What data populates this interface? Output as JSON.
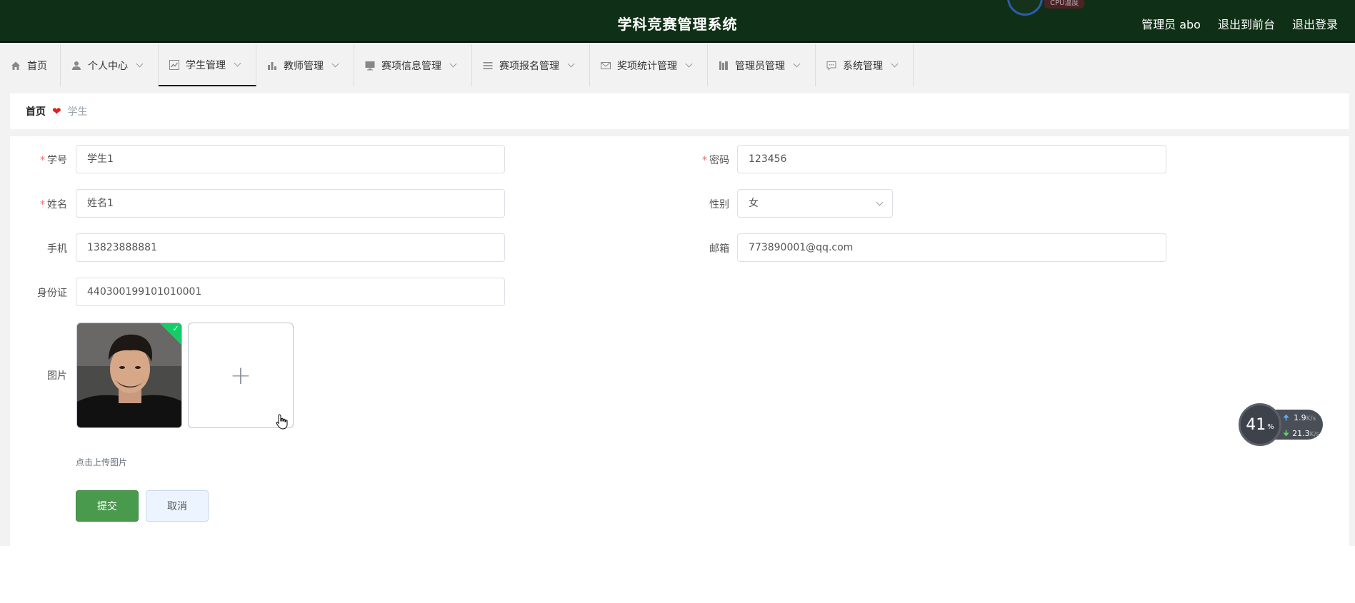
{
  "header": {
    "title": "学科竞赛管理系统",
    "cpu_label": "CPU温度",
    "links": [
      "管理员 abo",
      "退出到前台",
      "退出登录"
    ]
  },
  "menu": [
    {
      "label": "首页",
      "icon": "home-icon",
      "dropdown": false
    },
    {
      "label": "个人中心",
      "icon": "user-icon",
      "dropdown": true
    },
    {
      "label": "学生管理",
      "icon": "chart-line-icon",
      "dropdown": true,
      "active": true
    },
    {
      "label": "教师管理",
      "icon": "bar-chart-icon",
      "dropdown": true
    },
    {
      "label": "赛项信息管理",
      "icon": "monitor-icon",
      "dropdown": true
    },
    {
      "label": "赛项报名管理",
      "icon": "list-icon",
      "dropdown": true
    },
    {
      "label": "奖项统计管理",
      "icon": "mail-icon",
      "dropdown": true
    },
    {
      "label": "管理员管理",
      "icon": "book-icon",
      "dropdown": true
    },
    {
      "label": "系统管理",
      "icon": "chat-icon",
      "dropdown": true
    }
  ],
  "breadcrumb": {
    "home": "首页",
    "current": "学生"
  },
  "form": {
    "student_no": {
      "label": "学号",
      "value": "学生1",
      "required": true
    },
    "password": {
      "label": "密码",
      "value": "123456",
      "required": true
    },
    "name": {
      "label": "姓名",
      "value": "姓名1",
      "required": true
    },
    "gender": {
      "label": "性别",
      "value": "女"
    },
    "phone": {
      "label": "手机",
      "value": "13823888881"
    },
    "email": {
      "label": "邮箱",
      "value": "773890001@qq.com"
    },
    "id_card": {
      "label": "身份证",
      "value": "440300199101010001"
    },
    "image": {
      "label": "图片",
      "tip": "点击上传图片"
    },
    "submit_label": "提交",
    "cancel_label": "取消"
  },
  "net_widget": {
    "cpu": "41",
    "cpu_unit": "%",
    "up": "1.9",
    "down": "21.3",
    "unit": "K/s"
  },
  "colors": {
    "header_bg": "#0f3016",
    "primary_button": "#4a9a4e",
    "required_star": "#f56c6c"
  }
}
